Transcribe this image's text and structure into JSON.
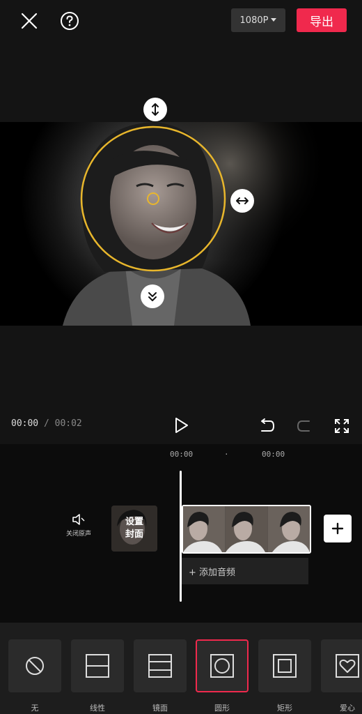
{
  "top_bar": {
    "resolution": "1080P",
    "export_label": "导出"
  },
  "playback": {
    "current_time": "00:00",
    "separator": " / ",
    "total_time": "00:02"
  },
  "timeline": {
    "ticks": [
      "00:00",
      "·",
      "00:00"
    ],
    "mute_label": "关闭原声",
    "cover_label_line1": "设置",
    "cover_label_line2": "封面",
    "add_audio_label": "+ 添加音频"
  },
  "mask_options": [
    {
      "label": "无",
      "icon": "no-mask-icon"
    },
    {
      "label": "线性",
      "icon": "linear-mask-icon"
    },
    {
      "label": "镜面",
      "icon": "mirror-mask-icon"
    },
    {
      "label": "圆形",
      "icon": "circle-mask-icon",
      "selected": true
    },
    {
      "label": "矩形",
      "icon": "rectangle-mask-icon"
    },
    {
      "label": "爱心",
      "icon": "heart-mask-icon"
    }
  ],
  "colors": {
    "accent": "#f0294d",
    "mask_outline": "#e8b62c"
  }
}
